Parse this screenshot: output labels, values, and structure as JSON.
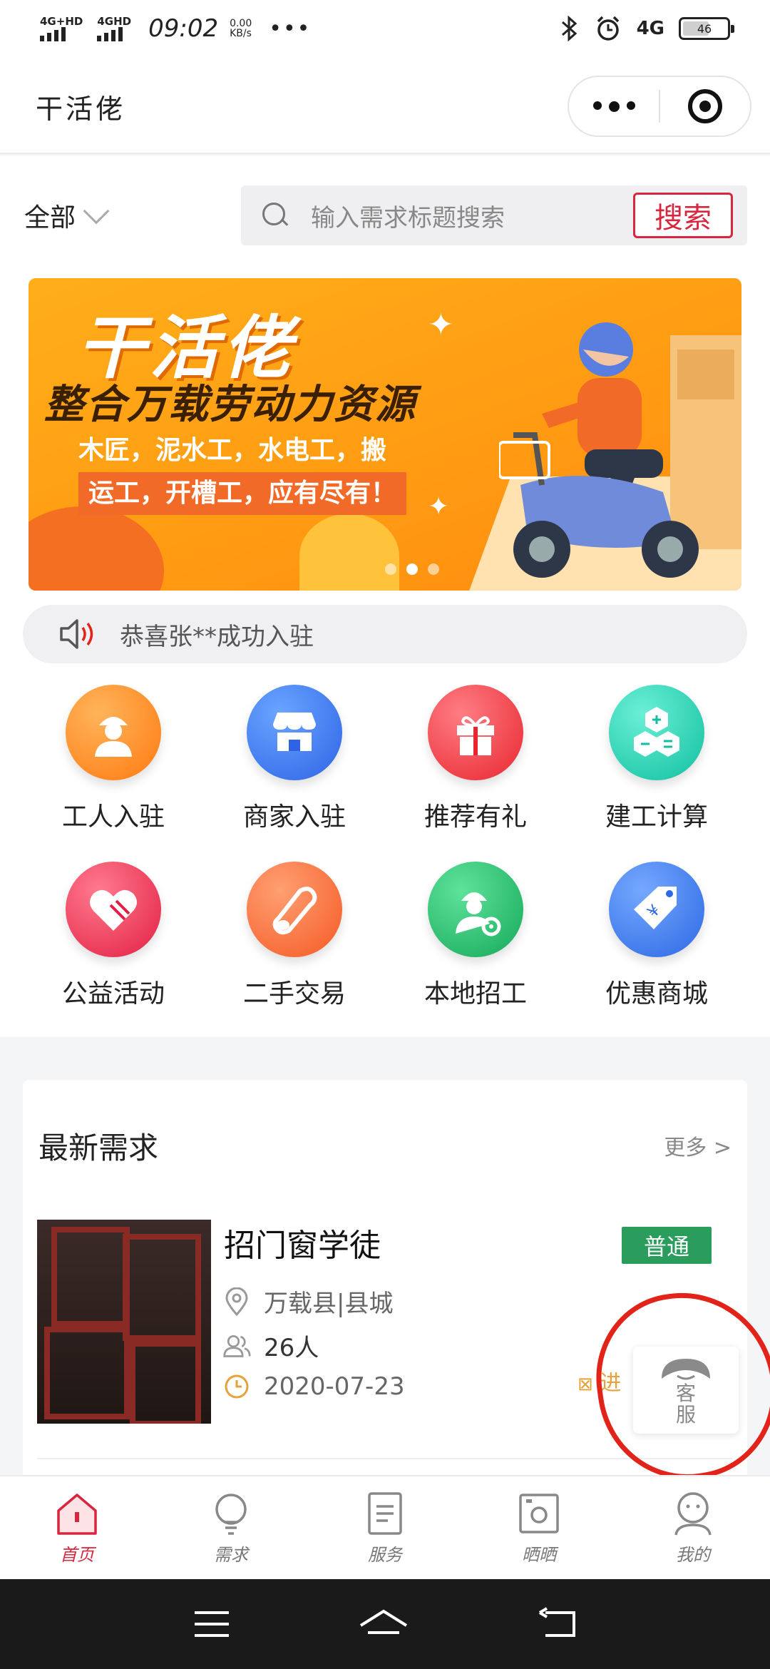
{
  "status_bar": {
    "sim1": "4G+HD",
    "sim2": "4GHD",
    "time": "09:02",
    "speed_value": "0.00",
    "speed_unit": "KB/s",
    "more": "•••",
    "network": "4G",
    "battery": "46"
  },
  "app": {
    "title": "干活佬"
  },
  "search": {
    "category": "全部",
    "placeholder": "输入需求标题搜索",
    "button": "搜索"
  },
  "banner": {
    "title": "干活佬",
    "subtitle": "整合万载劳动力资源",
    "line1": "木匠，泥水工，水电工，搬",
    "line2": "运工，开槽工，应有尽有！",
    "active_slide": 1,
    "slide_count": 3
  },
  "notice": {
    "text": "恭喜张**成功入驻"
  },
  "menu": [
    {
      "label": "工人入驻",
      "icon": "worker-icon",
      "color": "#ff8a1f"
    },
    {
      "label": "商家入驻",
      "icon": "shop-icon",
      "color": "#3d7bf2"
    },
    {
      "label": "推荐有礼",
      "icon": "gift-icon",
      "color": "#f2434a"
    },
    {
      "label": "建工计算",
      "icon": "calculator-icon",
      "color": "#1fcfae"
    },
    {
      "label": "公益活动",
      "icon": "heart-icon",
      "color": "#f03a55"
    },
    {
      "label": "二手交易",
      "icon": "pipe-icon",
      "color": "#ff6a3a"
    },
    {
      "label": "本地招工",
      "icon": "recruit-icon",
      "color": "#22b866"
    },
    {
      "label": "优惠商城",
      "icon": "price-tag-icon",
      "color": "#3a7ef0"
    }
  ],
  "latest": {
    "heading": "最新需求",
    "more": "更多 >",
    "items": [
      {
        "title": "招门窗学徒",
        "badge": "普通",
        "location": "万载县|县城",
        "people": "26人",
        "date": "2020-07-23",
        "enter": "进"
      }
    ]
  },
  "service": {
    "label_top": "客",
    "label_bottom": "服"
  },
  "tabs": [
    {
      "label": "首页",
      "icon": "home-icon",
      "active": true
    },
    {
      "label": "需求",
      "icon": "bulb-icon",
      "active": false
    },
    {
      "label": "服务",
      "icon": "document-icon",
      "active": false
    },
    {
      "label": "晒晒",
      "icon": "camera-icon",
      "active": false
    },
    {
      "label": "我的",
      "icon": "user-icon",
      "active": false
    }
  ],
  "colors": {
    "accent": "#d7263d",
    "badge": "#2a9d5c",
    "banner": "#ff9a12"
  }
}
